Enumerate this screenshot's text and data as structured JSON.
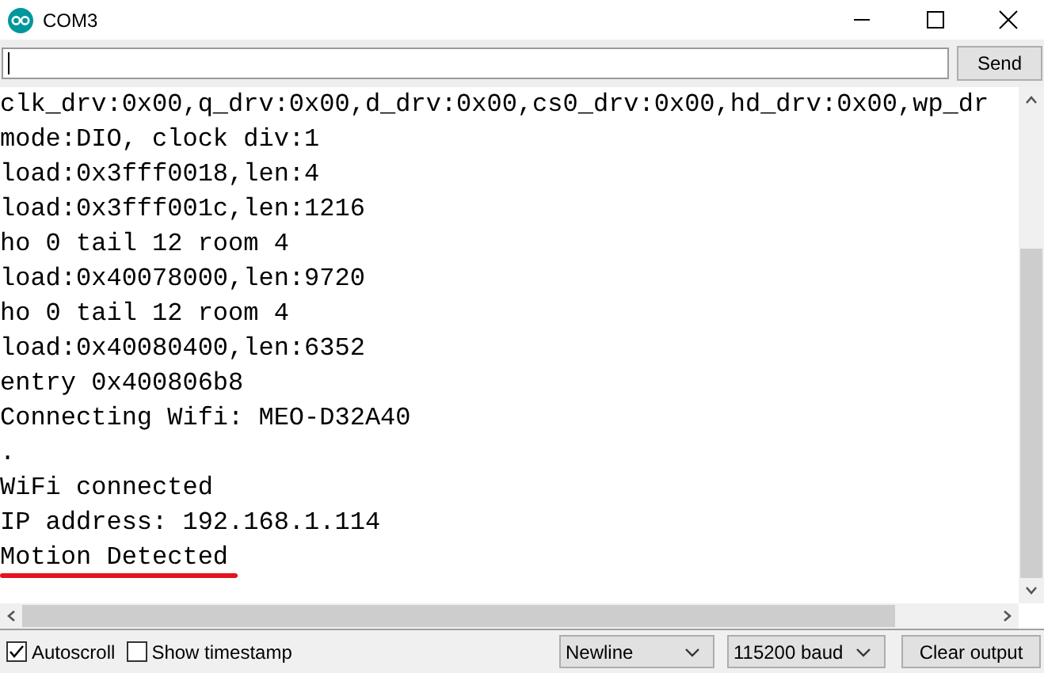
{
  "window": {
    "title": "COM3"
  },
  "input": {
    "button": "Send"
  },
  "output": {
    "lines": [
      {
        "text": "clk_drv:0x00,q_drv:0x00,d_drv:0x00,cs0_drv:0x00,hd_drv:0x00,wp_dr",
        "underlined": false
      },
      {
        "text": "mode:DIO, clock div:1",
        "underlined": false
      },
      {
        "text": "load:0x3fff0018,len:4",
        "underlined": false
      },
      {
        "text": "load:0x3fff001c,len:1216",
        "underlined": false
      },
      {
        "text": "ho 0 tail 12 room 4",
        "underlined": false
      },
      {
        "text": "load:0x40078000,len:9720",
        "underlined": false
      },
      {
        "text": "ho 0 tail 12 room 4",
        "underlined": false
      },
      {
        "text": "load:0x40080400,len:6352",
        "underlined": false
      },
      {
        "text": "entry 0x400806b8",
        "underlined": false
      },
      {
        "text": "Connecting Wifi: MEO-D32A40",
        "underlined": false
      },
      {
        "text": ".",
        "underlined": false
      },
      {
        "text": "WiFi connected",
        "underlined": false
      },
      {
        "text": "IP address: 192.168.1.114",
        "underlined": false
      },
      {
        "text": "Motion Detected",
        "underlined": true
      }
    ]
  },
  "footer": {
    "checkboxes": [
      {
        "label": "Autoscroll",
        "checked": true
      },
      {
        "label": "Show timestamp",
        "checked": false
      }
    ],
    "dropdowns": [
      "Newline",
      "115200 baud"
    ],
    "button": "Clear output"
  }
}
